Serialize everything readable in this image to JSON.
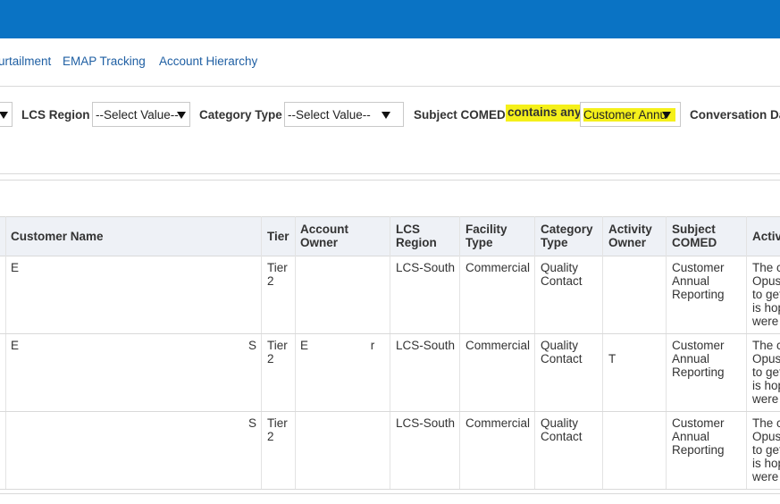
{
  "nav": {
    "links": [
      "urtailment",
      "EMAP Tracking",
      "Account Hierarchy"
    ]
  },
  "filters": {
    "lcs_region_label": "LCS Region",
    "lcs_region_value": "--Select Value--",
    "category_type_label": "Category Type",
    "category_type_value": "--Select Value--",
    "subject_label": "Subject COMED",
    "subject_operator": "contains any",
    "subject_value": "Customer Annu",
    "conversation_label": "Conversation Da"
  },
  "table": {
    "columns": [
      "Customer Name",
      "Tier",
      "Account Owner",
      "LCS Region",
      "Facility Type",
      "Category Type",
      "Activity Owner",
      "Subject COMED",
      "Activ"
    ],
    "rows": [
      {
        "customer_name": "E",
        "customer_name_tail": "",
        "tier": "Tier 2",
        "account_owner": "",
        "lcs_region": "LCS-South",
        "facility_type": "Commercial",
        "category_type": "Quality Contact",
        "activity_owner": "",
        "subject": "Customer Annual Reporting",
        "activity_desc": "The c Opus to get is hop were"
      },
      {
        "customer_name": "E",
        "customer_name_tail": "S",
        "tier": "Tier 2",
        "account_owner": "E r",
        "lcs_region": "LCS-South",
        "facility_type": "Commercial",
        "category_type": "Quality Contact",
        "activity_owner": "T",
        "subject": "Customer Annual Reporting",
        "activity_desc": "The c Opus to get is hop were"
      },
      {
        "customer_name": "",
        "customer_name_tail": "S",
        "tier": "Tier 2",
        "account_owner": "",
        "lcs_region": "LCS-South",
        "facility_type": "Commercial",
        "category_type": "Quality Contact",
        "activity_owner": "",
        "subject": "Customer Annual Reporting",
        "activity_desc": "The c Opus to get is hop were"
      }
    ]
  },
  "colors": {
    "top_bar": "#0a73c4",
    "link": "#1f5fa3",
    "highlight": "#f5f01a",
    "header_bg": "#eef1f6"
  }
}
